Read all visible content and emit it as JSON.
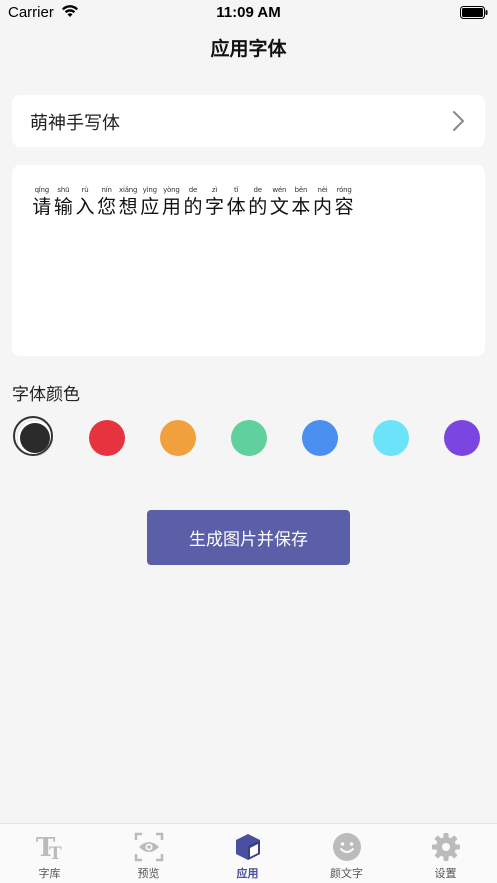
{
  "status_bar": {
    "carrier": "Carrier",
    "time": "11:09 AM"
  },
  "nav": {
    "title": "应用字体"
  },
  "font_select": {
    "value": "萌神手写体"
  },
  "text_input": {
    "placeholder_chars": [
      {
        "py": "qǐng",
        "hz": "请"
      },
      {
        "py": "shū",
        "hz": "输"
      },
      {
        "py": "rù",
        "hz": "入"
      },
      {
        "py": "nín",
        "hz": "您"
      },
      {
        "py": "xiǎng",
        "hz": "想"
      },
      {
        "py": "yìng",
        "hz": "应"
      },
      {
        "py": "yòng",
        "hz": "用"
      },
      {
        "py": "de",
        "hz": "的"
      },
      {
        "py": "zì",
        "hz": "字"
      },
      {
        "py": "tǐ",
        "hz": "体"
      },
      {
        "py": "de",
        "hz": "的"
      },
      {
        "py": "wén",
        "hz": "文"
      },
      {
        "py": "běn",
        "hz": "本"
      },
      {
        "py": "nèi",
        "hz": "内"
      },
      {
        "py": "róng",
        "hz": "容"
      }
    ]
  },
  "color_section": {
    "title": "字体颜色",
    "colors": [
      "#2b2b2b",
      "#e5343f",
      "#f0a13d",
      "#5fd09e",
      "#4a8ef0",
      "#6be3f8",
      "#7a45e0"
    ],
    "selected_index": 0
  },
  "save_button": {
    "label": "生成图片并保存"
  },
  "tabs": [
    {
      "label": "字库",
      "icon": "font-library-icon",
      "active": false
    },
    {
      "label": "预览",
      "icon": "preview-eye-icon",
      "active": false
    },
    {
      "label": "应用",
      "icon": "apply-cube-icon",
      "active": true
    },
    {
      "label": "颜文字",
      "icon": "smiley-icon",
      "active": false
    },
    {
      "label": "设置",
      "icon": "gear-icon",
      "active": false
    }
  ]
}
